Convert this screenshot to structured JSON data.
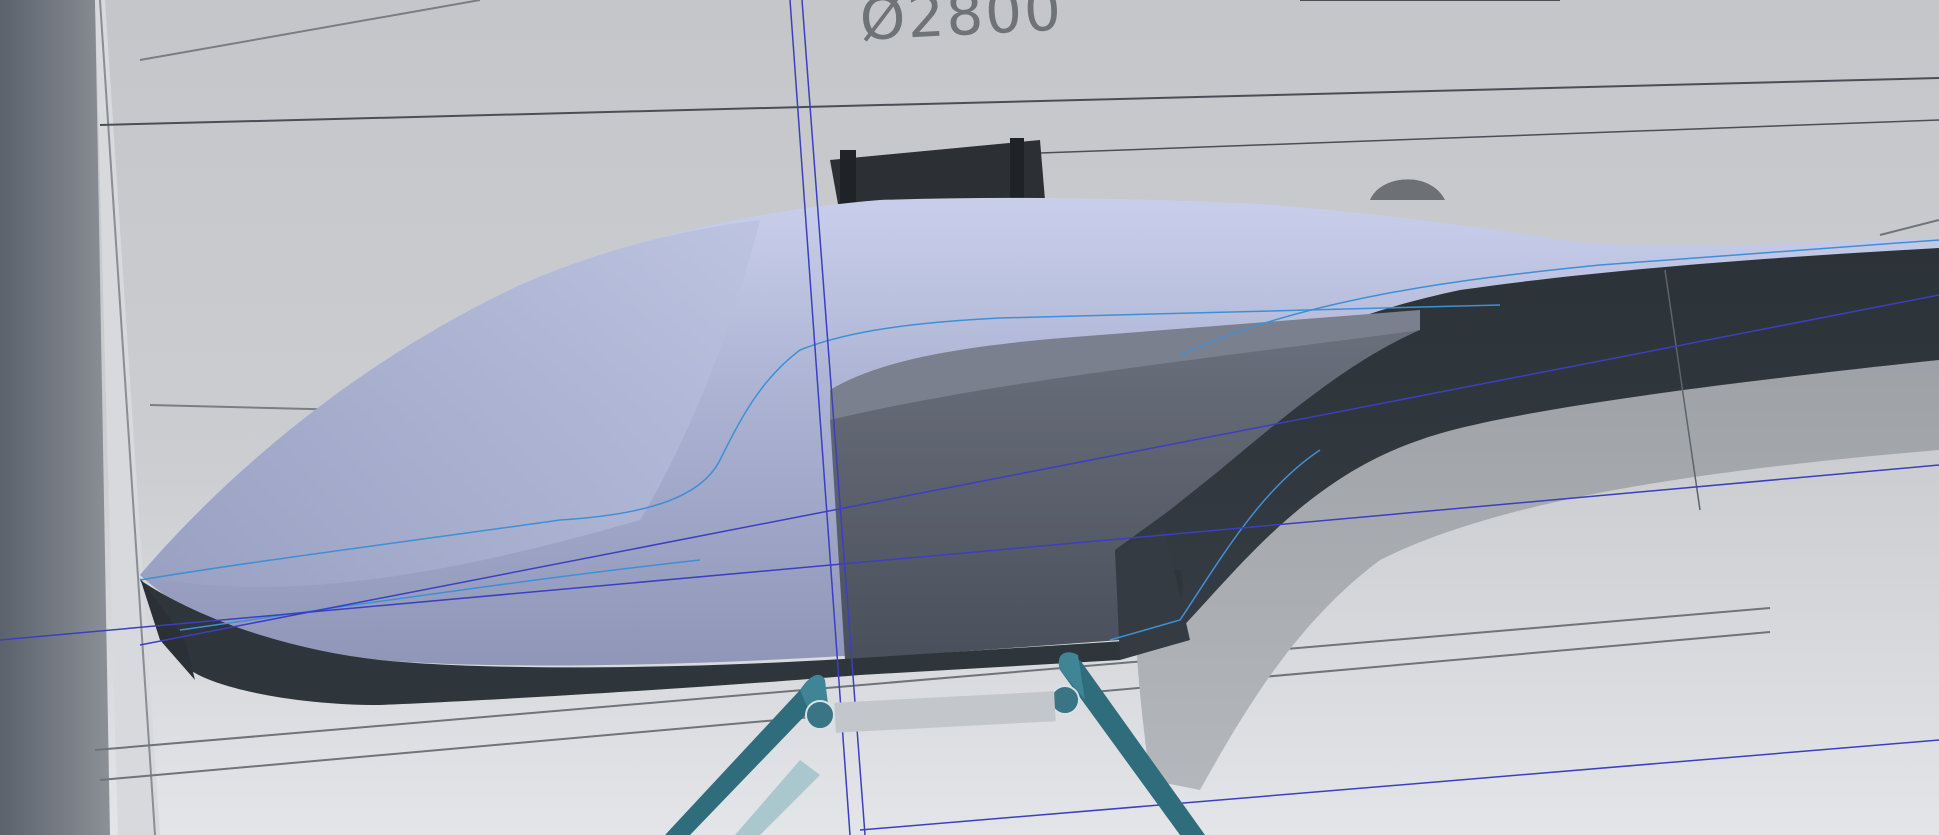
{
  "viewport": {
    "dimension_label": "Ø2800",
    "colors": {
      "background_light": "#e3e5e8",
      "background_mid": "#c4c6ca",
      "body_light": "#c3c9e6",
      "body_mid": "#a2a9c8",
      "body_shadow": "#8c93b4",
      "trim_dark": "#2e353b",
      "interior_dark": "#565c69",
      "ground_shadow": "#a3a7ab",
      "skid_teal": "#2f6d7c",
      "edge_blue": "#3f8fd6",
      "datum_blue": "#3b3fc0",
      "construction_gray": "#4a4e55"
    },
    "parts": {
      "fuselage": "fuselage-body",
      "trim": "fuselage-dark-trim",
      "tail_boom": "tail-boom",
      "landing_skid": "landing-skid-struts",
      "rotor_hub": "rotor-hub"
    }
  }
}
